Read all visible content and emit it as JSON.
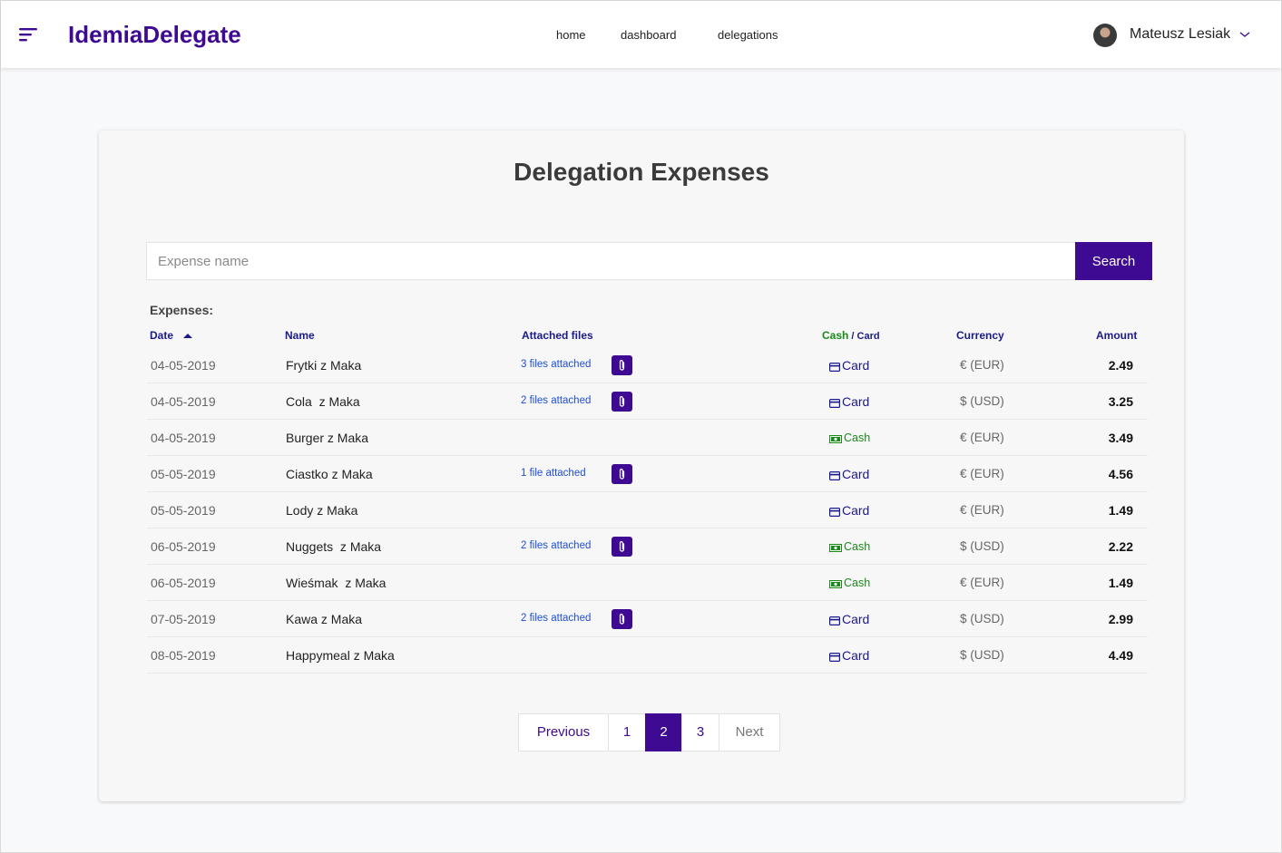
{
  "app": {
    "brand": "IdemiaDelegate"
  },
  "nav": {
    "home": "home",
    "dashboard": "dashboard",
    "delegations": "delegations"
  },
  "user": {
    "name": "Mateusz Lesiak"
  },
  "page": {
    "title": "Delegation Expenses"
  },
  "search": {
    "placeholder": "Expense name",
    "value": "",
    "button": "Search"
  },
  "expenses": {
    "label": "Expenses:",
    "columns": {
      "date": "Date",
      "name": "Name",
      "files": "Attached files",
      "cash": "Cash",
      "sep": " / ",
      "card": "Card",
      "currency": "Currency",
      "amount": "Amount"
    },
    "sort": {
      "column": "Date",
      "direction": "ascending"
    },
    "rows": [
      {
        "date": "04-05-2019",
        "name": "Frytki z Maka",
        "files": "3 files attached",
        "payment": "Card",
        "currency": "€ (EUR)",
        "amount": "2.49"
      },
      {
        "date": "04-05-2019",
        "name": "Cola  z Maka",
        "files": "2 files attached",
        "payment": "Card",
        "currency": "$ (USD)",
        "amount": "3.25"
      },
      {
        "date": "04-05-2019",
        "name": "Burger z Maka",
        "files": "",
        "payment": "Cash",
        "currency": "€ (EUR)",
        "amount": "3.49"
      },
      {
        "date": "05-05-2019",
        "name": "Ciastko z Maka",
        "files": "1 file attached",
        "payment": "Card",
        "currency": "€ (EUR)",
        "amount": "4.56"
      },
      {
        "date": "05-05-2019",
        "name": "Lody z Maka",
        "files": "",
        "payment": "Card",
        "currency": "€ (EUR)",
        "amount": "1.49"
      },
      {
        "date": "06-05-2019",
        "name": "Nuggets  z Maka",
        "files": "2 files attached",
        "payment": "Cash",
        "currency": "$ (USD)",
        "amount": "2.22"
      },
      {
        "date": "06-05-2019",
        "name": "Wieśmak  z Maka",
        "files": "",
        "payment": "Cash",
        "currency": "€ (EUR)",
        "amount": "1.49"
      },
      {
        "date": "07-05-2019",
        "name": "Kawa z Maka",
        "files": "2 files attached",
        "payment": "Card",
        "currency": "$ (USD)",
        "amount": "2.99"
      },
      {
        "date": "08-05-2019",
        "name": "Happymeal z Maka",
        "files": "",
        "payment": "Card",
        "currency": "$ (USD)",
        "amount": "4.49"
      }
    ]
  },
  "pagination": {
    "previous": "Previous",
    "pages": [
      "1",
      "2",
      "3"
    ],
    "current": "2",
    "next": "Next"
  },
  "colors": {
    "brand": "#3d0a91",
    "card_text": "#1a1a8c",
    "cash_text": "#1a8a1a",
    "link": "#1d4ed8"
  },
  "icons": {
    "menu": "menu-icon",
    "chevron": "chevron-down-icon",
    "attachment": "paperclip-icon",
    "card": "credit-card-icon",
    "cash": "banknote-icon",
    "sort": "sort-asc-icon"
  }
}
